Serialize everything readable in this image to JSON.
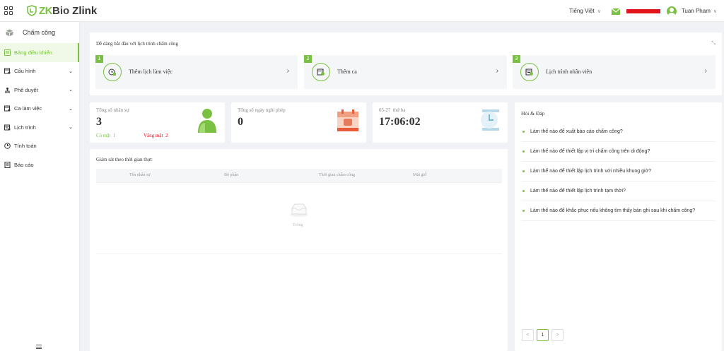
{
  "header": {
    "brand_zk": "ZK",
    "brand_bio": "Bio",
    "brand_zlink": "Zlink",
    "language": "Tiếng Việt",
    "user_name": "Tuan Pham"
  },
  "sidebar": {
    "module_title": "Chấm công",
    "items": [
      {
        "label": "Bảng điều khiển",
        "icon": "dashboard-icon",
        "has_arrow": false,
        "active": true
      },
      {
        "label": "Cấu hình",
        "icon": "config-icon",
        "has_arrow": true,
        "active": false
      },
      {
        "label": "Phê duyệt",
        "icon": "approval-icon",
        "has_arrow": true,
        "active": false
      },
      {
        "label": "Ca làm việc",
        "icon": "shift-icon",
        "has_arrow": true,
        "active": false
      },
      {
        "label": "Lịch trình",
        "icon": "schedule-icon",
        "has_arrow": true,
        "active": false
      },
      {
        "label": "Tính toán",
        "icon": "calculate-icon",
        "has_arrow": false,
        "active": false
      },
      {
        "label": "Báo cáo",
        "icon": "report-icon",
        "has_arrow": false,
        "active": false
      }
    ]
  },
  "quick_start": {
    "title": "Dễ dàng bắt đầu với lịch trình chấm công",
    "steps": [
      {
        "num": "1",
        "label": "Thêm lịch làm việc"
      },
      {
        "num": "2",
        "label": "Thêm ca"
      },
      {
        "num": "3",
        "label": "Lịch trình nhân viên"
      }
    ]
  },
  "stats": {
    "employees": {
      "title": "Tổng số nhân sự",
      "value": "3",
      "present_label": "Có mặt",
      "present_value": "1",
      "absent_label": "Vắng mặt",
      "absent_value": "2"
    },
    "leave": {
      "title": "Tổng số ngày nghỉ phép",
      "value": "0"
    },
    "clock": {
      "date": "05-27",
      "weekday": "thứ ba",
      "time": "17:06:02"
    }
  },
  "monitor": {
    "title": "Giám sát theo thời gian thực",
    "columns": [
      "Tên nhân sự",
      "Bộ phận",
      "Thời gian chấm công",
      "Múi giờ"
    ],
    "empty_text": "Trống"
  },
  "faq": {
    "title": "Hỏi & Đáp",
    "items": [
      "Làm thế nào để xuất báo cáo chấm công?",
      "Làm thế nào để thiết lập vị trí chấm công trên di động?",
      "Làm thế nào để thiết lập lịch trình với nhiều khung giờ?",
      "Làm thế nào để thiết lập lịch trình tạm thời?",
      "Làm thế nào để khắc phục nếu không tìm thấy bản ghi sau khi chấm công?"
    ],
    "pager": {
      "prev": "<",
      "current": "1",
      "next": ">"
    }
  },
  "colors": {
    "accent": "#7ac143",
    "danger": "#e0121a"
  }
}
